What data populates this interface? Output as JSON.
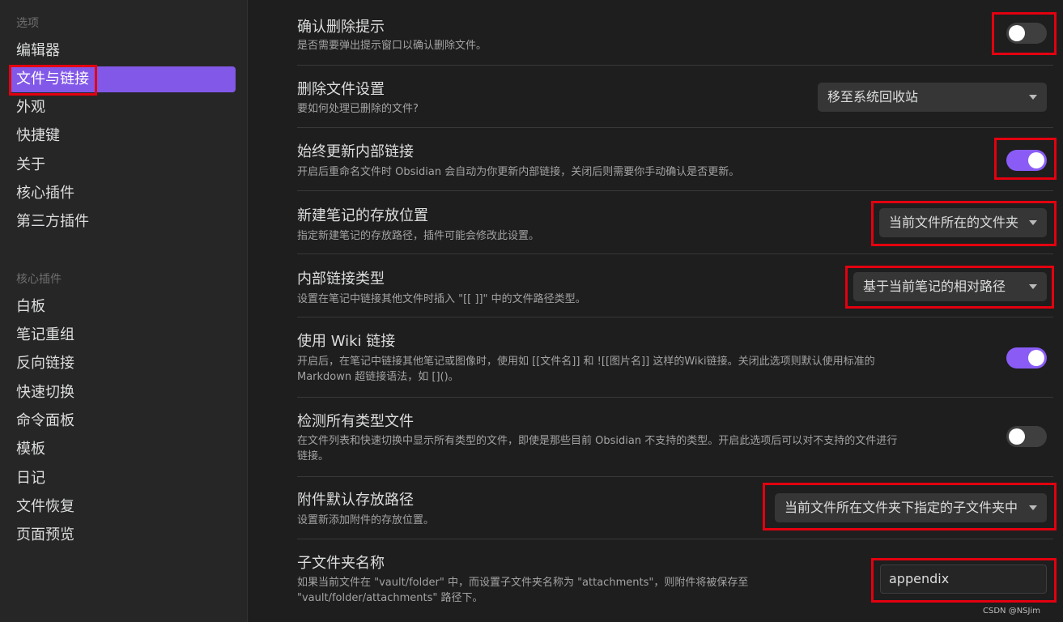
{
  "sidebar": {
    "options_heading": "选项",
    "options": [
      "编辑器",
      "文件与链接",
      "外观",
      "快捷键",
      "关于",
      "核心插件",
      "第三方插件"
    ],
    "core_heading": "核心插件",
    "core_plugins": [
      "白板",
      "笔记重组",
      "反向链接",
      "快速切换",
      "命令面板",
      "模板",
      "日记",
      "文件恢复",
      "页面预览"
    ]
  },
  "settings": {
    "confirm_delete": {
      "title": "确认删除提示",
      "desc": "是否需要弹出提示窗口以确认删除文件。",
      "enabled": false
    },
    "delete_files": {
      "title": "删除文件设置",
      "desc": "要如何处理已删除的文件?",
      "value": "移至系统回收站"
    },
    "auto_update_links": {
      "title": "始终更新内部链接",
      "desc": "开启后重命名文件时 Obsidian 会自动为你更新内部链接，关闭后则需要你手动确认是否更新。",
      "enabled": true
    },
    "new_note_location": {
      "title": "新建笔记的存放位置",
      "desc": "指定新建笔记的存放路径，插件可能会修改此设置。",
      "value": "当前文件所在的文件夹"
    },
    "link_format": {
      "title": "内部链接类型",
      "desc": "设置在笔记中链接其他文件时插入 \"[[ ]]\" 中的文件路径类型。",
      "value": "基于当前笔记的相对路径"
    },
    "wiki_links": {
      "title": "使用 Wiki 链接",
      "desc_line1": "开启后，在笔记中链接其他笔记或图像时，使用如 [[文件名]] 和 ![[图片名]] 这样的Wiki链接。关闭此选项则默认使用标准的",
      "desc_line2": "Markdown 超链接语法，如 []()。",
      "enabled": true
    },
    "detect_all_types": {
      "title": "检测所有类型文件",
      "desc_line1": "在文件列表和快速切换中显示所有类型的文件，即使是那些目前 Obsidian 不支持的类型。开启此选项后可以对不支持的文件进行",
      "desc_line2": "链接。",
      "enabled": false
    },
    "attachment_location": {
      "title": "附件默认存放路径",
      "desc": "设置新添加附件的存放位置。",
      "value": "当前文件所在文件夹下指定的子文件夹中"
    },
    "subfolder_name": {
      "title": "子文件夹名称",
      "desc_line1": "如果当前文件在 \"vault/folder\" 中，而设置子文件夹名称为 \"attachments\"，则附件将被保存至",
      "desc_line2": "\"vault/folder/attachments\" 路径下。",
      "value": "appendix"
    }
  },
  "watermark": "CSDN @NSJim",
  "colors": {
    "accent": "#8a5cf5",
    "highlight_box": "#e3000f"
  }
}
